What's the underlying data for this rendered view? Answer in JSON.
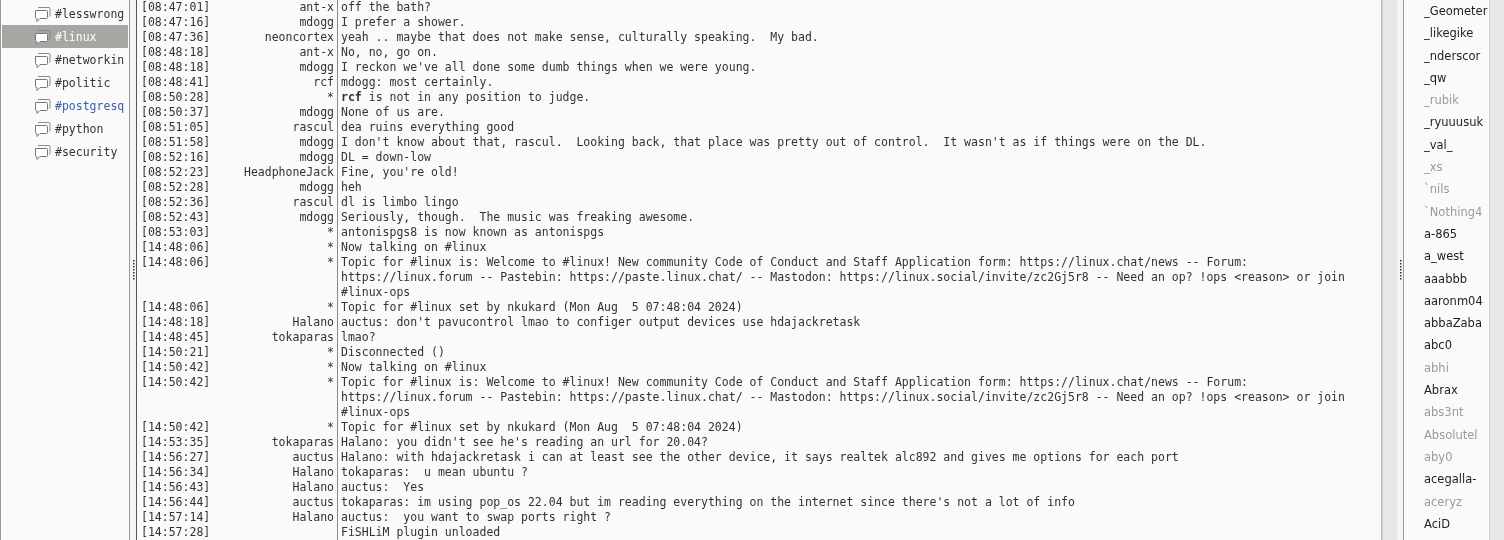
{
  "channels": [
    {
      "label": "#lesswrong",
      "selected": false,
      "highlighted": false
    },
    {
      "label": "#linux",
      "selected": true,
      "highlighted": false
    },
    {
      "label": "#networkin",
      "selected": false,
      "highlighted": false
    },
    {
      "label": "#politic",
      "selected": false,
      "highlighted": false
    },
    {
      "label": "#postgresq",
      "selected": false,
      "highlighted": true
    },
    {
      "label": "#python",
      "selected": false,
      "highlighted": false
    },
    {
      "label": "#security",
      "selected": false,
      "highlighted": false
    }
  ],
  "messages": [
    {
      "time": "[08:47:01]",
      "nick": "ant-x",
      "text": "off the bath?"
    },
    {
      "time": "[08:47:16]",
      "nick": "mdogg",
      "text": "I prefer a shower."
    },
    {
      "time": "[08:47:36]",
      "nick": "neoncortex",
      "text": "yeah .. maybe that does not make sense, culturally speaking.  My bad."
    },
    {
      "time": "[08:48:18]",
      "nick": "ant-x",
      "text": "No, no, go on."
    },
    {
      "time": "[08:48:18]",
      "nick": "mdogg",
      "text": "I reckon we've all done some dumb things when we were young."
    },
    {
      "time": "[08:48:41]",
      "nick": "rcf",
      "text": "mdogg: most certainly."
    },
    {
      "time": "[08:50:28]",
      "nick": "*",
      "text": "**rcf** is not in any position to judge."
    },
    {
      "time": "[08:50:37]",
      "nick": "mdogg",
      "text": "None of us are."
    },
    {
      "time": "[08:51:05]",
      "nick": "rascul",
      "text": "dea ruins everything good"
    },
    {
      "time": "[08:51:58]",
      "nick": "mdogg",
      "text": "I don't know about that, rascul.  Looking back, that place was pretty out of control.  It wasn't as if things were on the DL."
    },
    {
      "time": "[08:52:16]",
      "nick": "mdogg",
      "text": "DL = down-low"
    },
    {
      "time": "[08:52:23]",
      "nick": "HeadphoneJack",
      "text": "Fine, you're old!"
    },
    {
      "time": "[08:52:28]",
      "nick": "mdogg",
      "text": "heh"
    },
    {
      "time": "[08:52:36]",
      "nick": "rascul",
      "text": "dl is limbo lingo"
    },
    {
      "time": "[08:52:43]",
      "nick": "mdogg",
      "text": "Seriously, though.  The music was freaking awesome."
    },
    {
      "time": "[08:53:03]",
      "nick": "*",
      "text": "antonispgs8 is now known as antonispgs"
    },
    {
      "time": "[14:48:06]",
      "nick": "*",
      "text": "Now talking on #linux"
    },
    {
      "time": "[14:48:06]",
      "nick": "*",
      "text": "Topic for #linux is: Welcome to #linux! New community Code of Conduct and Staff Application form: https://linux.chat/news -- Forum: https://linux.forum -- Pastebin: https://paste.linux.chat/ -- Mastodon: https://linux.social/invite/zc2Gj5r8 -- Need an op? !ops <reason> or join #linux-ops"
    },
    {
      "time": "[14:48:06]",
      "nick": "*",
      "text": "Topic for #linux set by nkukard (Mon Aug  5 07:48:04 2024)"
    },
    {
      "time": "[14:48:18]",
      "nick": "Halano",
      "text": "auctus: don't pavucontrol lmao to configer output devices use hdajackretask"
    },
    {
      "time": "[14:48:45]",
      "nick": "tokaparas",
      "text": "lmao?"
    },
    {
      "time": "[14:50:21]",
      "nick": "*",
      "text": "Disconnected ()"
    },
    {
      "time": "[14:50:42]",
      "nick": "*",
      "text": "Now talking on #linux"
    },
    {
      "time": "[14:50:42]",
      "nick": "*",
      "text": "Topic for #linux is: Welcome to #linux! New community Code of Conduct and Staff Application form: https://linux.chat/news -- Forum: https://linux.forum -- Pastebin: https://paste.linux.chat/ -- Mastodon: https://linux.social/invite/zc2Gj5r8 -- Need an op? !ops <reason> or join #linux-ops"
    },
    {
      "time": "[14:50:42]",
      "nick": "*",
      "text": "Topic for #linux set by nkukard (Mon Aug  5 07:48:04 2024)"
    },
    {
      "time": "[14:53:35]",
      "nick": "tokaparas",
      "text": "Halano: you didn't see he's reading an url for 20.04?"
    },
    {
      "time": "[14:56:27]",
      "nick": "auctus",
      "text": "Halano: with hdajackretask i can at least see the other device, it says realtek alc892 and gives me options for each port"
    },
    {
      "time": "[14:56:34]",
      "nick": "Halano",
      "text": "tokaparas:  u mean ubuntu ?"
    },
    {
      "time": "[14:56:43]",
      "nick": "Halano",
      "text": "auctus:  Yes"
    },
    {
      "time": "[14:56:44]",
      "nick": "auctus",
      "text": "tokaparas: im using pop_os 22.04 but im reading everything on the internet since there's not a lot of info"
    },
    {
      "time": "[14:57:14]",
      "nick": "Halano",
      "text": "auctus:  you want to swap ports right ?"
    },
    {
      "time": "[14:57:28]",
      "text": "FiSHLiM plugin unloaded"
    }
  ],
  "users": [
    {
      "name": "_Geometer",
      "away": false
    },
    {
      "name": "_likegike",
      "away": false
    },
    {
      "name": "_nderscor",
      "away": false
    },
    {
      "name": "_qw",
      "away": false
    },
    {
      "name": "_rubik",
      "away": true
    },
    {
      "name": "_ryuuusuk",
      "away": false
    },
    {
      "name": "_val_",
      "away": false
    },
    {
      "name": "_xs",
      "away": true
    },
    {
      "name": "`nils",
      "away": true
    },
    {
      "name": "`Nothing4",
      "away": true
    },
    {
      "name": "a-865",
      "away": false
    },
    {
      "name": "a_west",
      "away": false
    },
    {
      "name": "aaabbb",
      "away": false
    },
    {
      "name": "aaronm04",
      "away": false
    },
    {
      "name": "abbaZaba",
      "away": false
    },
    {
      "name": "abc0",
      "away": false
    },
    {
      "name": "abhi",
      "away": true
    },
    {
      "name": "Abrax",
      "away": false
    },
    {
      "name": "abs3nt",
      "away": true
    },
    {
      "name": "Absolutel",
      "away": true
    },
    {
      "name": "aby0",
      "away": true
    },
    {
      "name": "acegalla-",
      "away": false
    },
    {
      "name": "aceryz",
      "away": true
    },
    {
      "name": "AciD",
      "away": false
    }
  ]
}
